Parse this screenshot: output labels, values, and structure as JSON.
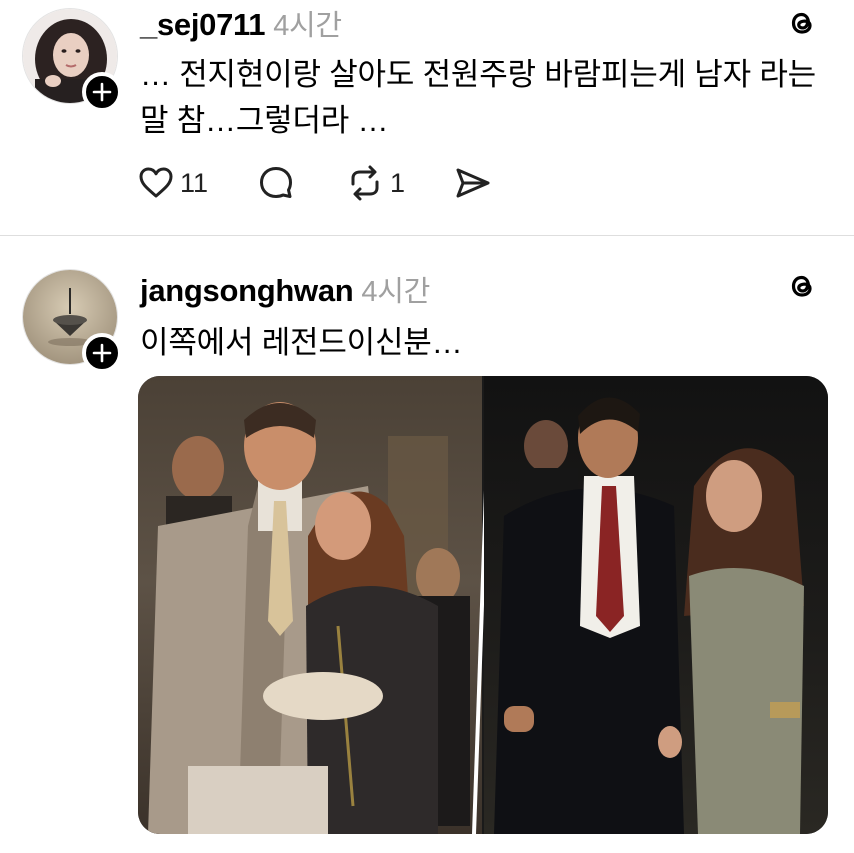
{
  "posts": [
    {
      "username": "_sej0711",
      "time": "4시간",
      "text": "… 전지현이랑 살아도 전원주랑 바람피는게 남자 라는 말 참…그렇더라 …",
      "likes": "11",
      "reposts": "1"
    },
    {
      "username": "jangsonghwan",
      "time": "4시간",
      "text": "이쪽에서 레전드이신분…"
    }
  ],
  "icons": {
    "threads": "threads-logo-icon",
    "follow": "plus-icon",
    "like": "heart-icon",
    "comment": "comment-icon",
    "repost": "repost-icon",
    "share": "send-icon"
  },
  "colors": {
    "text": "#000000",
    "muted": "#a0a0a0",
    "divider": "#dedede"
  }
}
